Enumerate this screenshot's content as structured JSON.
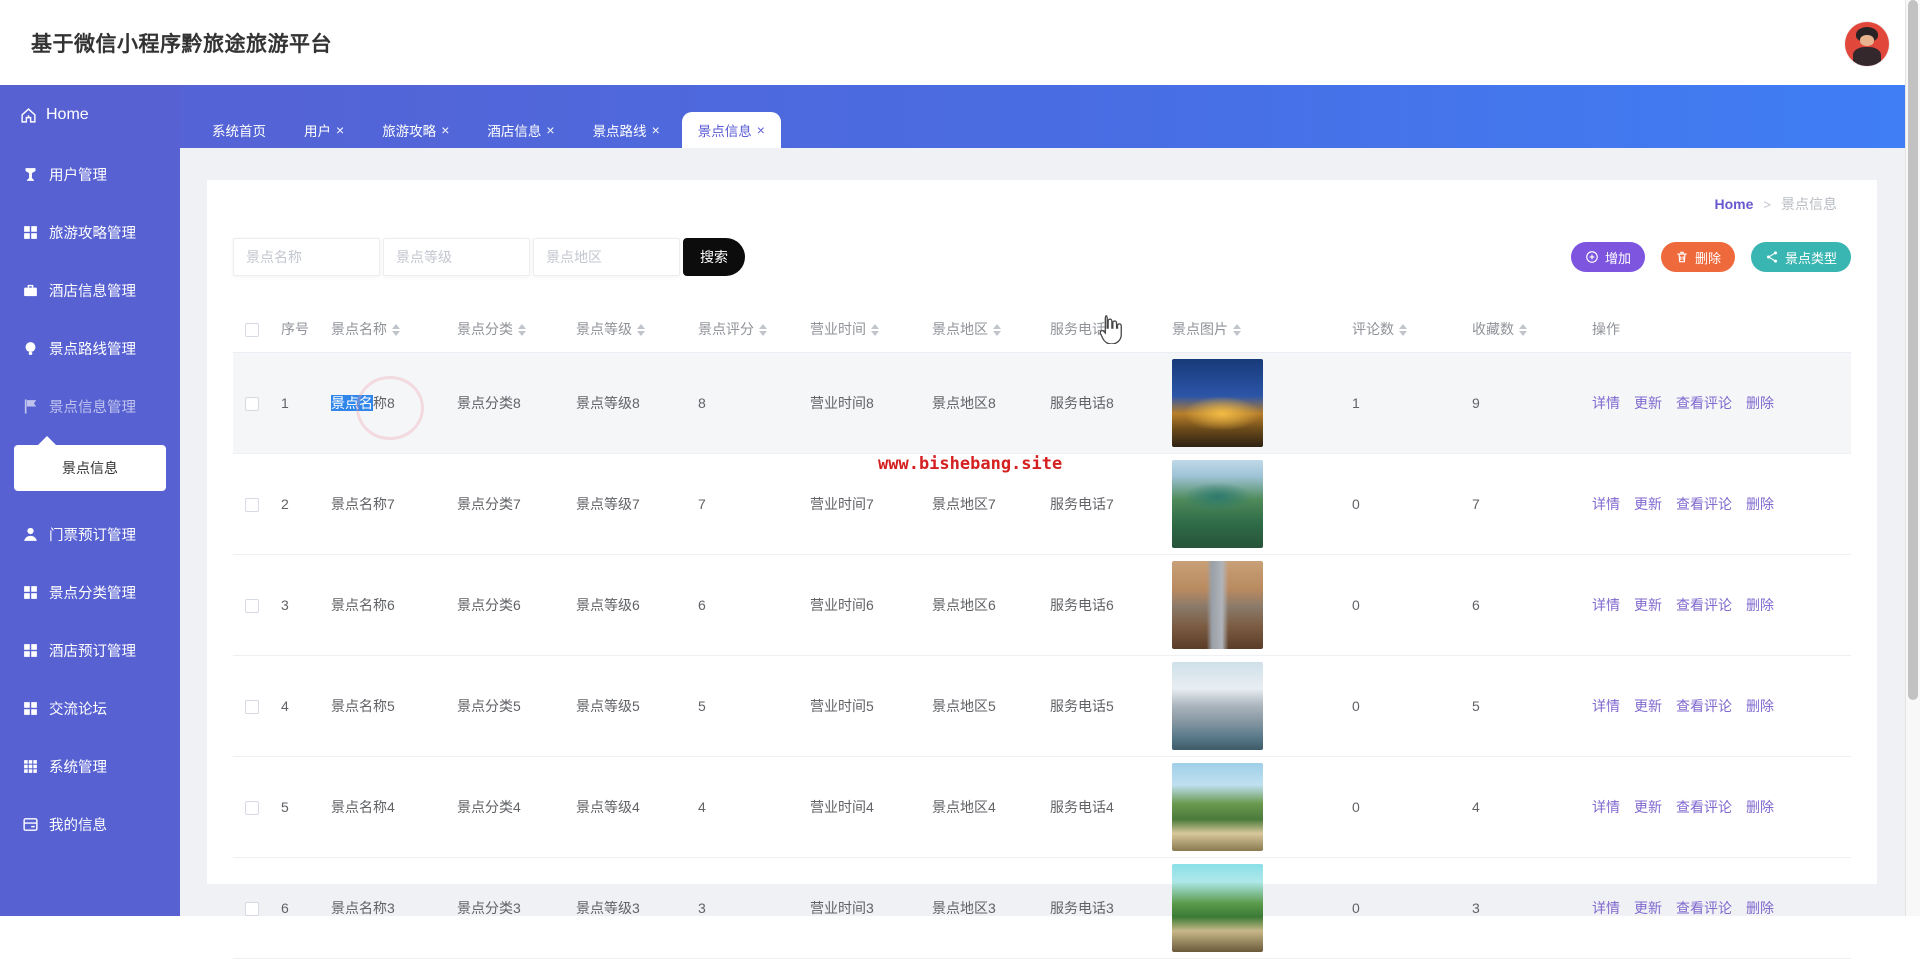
{
  "app": {
    "title": "基于微信小程序黔旅途旅游平台"
  },
  "ui": {
    "close_glyph": "×"
  },
  "sidebar": {
    "home_label": "Home",
    "items": [
      {
        "label": "用户管理",
        "icon": "user-icon"
      },
      {
        "label": "旅游攻略管理",
        "icon": "grid-icon"
      },
      {
        "label": "酒店信息管理",
        "icon": "briefcase-icon"
      },
      {
        "label": "景点路线管理",
        "icon": "bulb-icon"
      },
      {
        "label": "景点信息管理",
        "icon": "flag-icon"
      },
      {
        "label": "门票预订管理",
        "icon": "person-icon"
      },
      {
        "label": "景点分类管理",
        "icon": "grid-icon"
      },
      {
        "label": "酒店预订管理",
        "icon": "grid-icon"
      },
      {
        "label": "交流论坛",
        "icon": "grid-icon"
      },
      {
        "label": "系统管理",
        "icon": "grid9-icon"
      },
      {
        "label": "我的信息",
        "icon": "window-icon"
      }
    ],
    "submenu_label": "景点信息"
  },
  "tabs": [
    {
      "label": "系统首页",
      "closable": false,
      "active": false
    },
    {
      "label": "用户",
      "closable": true,
      "active": false
    },
    {
      "label": "旅游攻略",
      "closable": true,
      "active": false
    },
    {
      "label": "酒店信息",
      "closable": true,
      "active": false
    },
    {
      "label": "景点路线",
      "closable": true,
      "active": false
    },
    {
      "label": "景点信息",
      "closable": true,
      "active": true
    }
  ],
  "breadcrumb": {
    "home": "Home",
    "separator": ">",
    "current": "景点信息"
  },
  "toolbar": {
    "filters": [
      {
        "placeholder": "景点名称"
      },
      {
        "placeholder": "景点等级"
      },
      {
        "placeholder": "景点地区"
      }
    ],
    "search_label": "搜索",
    "add_label": "增加",
    "delete_label": "删除",
    "type_label": "景点类型"
  },
  "watermark": "www.bishebang.site",
  "table": {
    "headers": [
      {
        "label": "序号",
        "sortable": false
      },
      {
        "label": "景点名称",
        "sortable": true
      },
      {
        "label": "景点分类",
        "sortable": true
      },
      {
        "label": "景点等级",
        "sortable": true
      },
      {
        "label": "景点评分",
        "sortable": true
      },
      {
        "label": "营业时间",
        "sortable": true
      },
      {
        "label": "景点地区",
        "sortable": true
      },
      {
        "label": "服务电话",
        "sortable": true
      },
      {
        "label": "景点图片",
        "sortable": true
      },
      {
        "label": "评论数",
        "sortable": true
      },
      {
        "label": "收藏数",
        "sortable": true
      },
      {
        "label": "操作",
        "sortable": false
      }
    ],
    "action_labels": [
      "详情",
      "更新",
      "查看评论",
      "删除"
    ],
    "rows": [
      {
        "index": "1",
        "name_selected": "景点名",
        "name_rest": "称8",
        "category": "景点分类8",
        "level": "景点等级8",
        "score": "8",
        "hours": "营业时间8",
        "area": "景点地区8",
        "phone": "服务电话8",
        "comments": "1",
        "favorites": "9",
        "image": "night-temple-photo"
      },
      {
        "index": "2",
        "name": "景点名称7",
        "category": "景点分类7",
        "level": "景点等级7",
        "score": "7",
        "hours": "营业时间7",
        "area": "景点地区7",
        "phone": "服务电话7",
        "comments": "0",
        "favorites": "7",
        "image": "green-pavilion-photo"
      },
      {
        "index": "3",
        "name": "景点名称6",
        "category": "景点分类6",
        "level": "景点等级6",
        "score": "6",
        "hours": "营业时间6",
        "area": "景点地区6",
        "phone": "服务电话6",
        "comments": "0",
        "favorites": "6",
        "image": "autumn-pagoda-photo"
      },
      {
        "index": "4",
        "name": "景点名称5",
        "category": "景点分类5",
        "level": "景点等级5",
        "score": "5",
        "hours": "营业时间5",
        "area": "景点地区5",
        "phone": "服务电话5",
        "comments": "0",
        "favorites": "5",
        "image": "water-town-photo"
      },
      {
        "index": "5",
        "name": "景点名称4",
        "category": "景点分类4",
        "level": "景点等级4",
        "score": "4",
        "hours": "营业时间4",
        "area": "景点地区4",
        "phone": "服务电话4",
        "comments": "0",
        "favorites": "4",
        "image": "great-wall-photo"
      },
      {
        "index": "6",
        "name": "景点名称3",
        "category": "景点分类3",
        "level": "景点等级3",
        "score": "3",
        "hours": "营业时间3",
        "area": "景点地区3",
        "phone": "服务电话3",
        "comments": "0",
        "favorites": "3",
        "image": "wall-tower-photo"
      }
    ]
  },
  "colors": {
    "sidebar": "#5761d2",
    "band_right": "#3f7ef5",
    "add_button": "#7d55df",
    "delete_button": "#ee6a3c",
    "type_button": "#3ab6b2",
    "search_button": "#0c0c0c",
    "link": "#8069cf",
    "breadcrumb_home": "#6959cf",
    "selection": "#3186ea",
    "watermark": "#d42020"
  }
}
